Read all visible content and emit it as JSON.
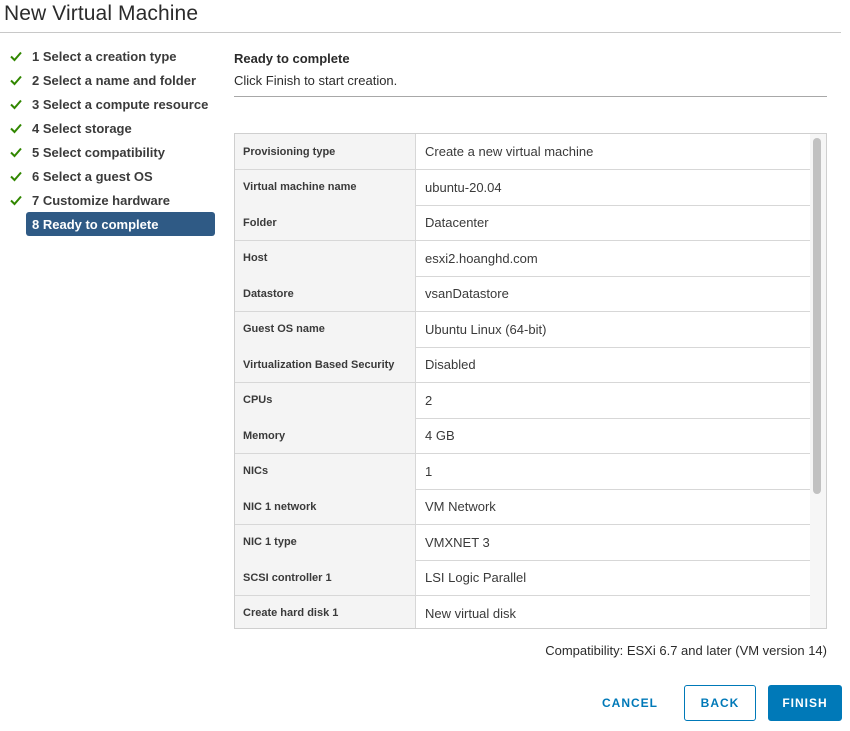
{
  "window": {
    "title": "New Virtual Machine"
  },
  "steps": [
    {
      "label": "1 Select a creation type",
      "done": true
    },
    {
      "label": "2 Select a name and folder",
      "done": true
    },
    {
      "label": "3 Select a compute resource",
      "done": true
    },
    {
      "label": "4 Select storage",
      "done": true
    },
    {
      "label": "5 Select compatibility",
      "done": true
    },
    {
      "label": "6 Select a guest OS",
      "done": true
    },
    {
      "label": "7 Customize hardware",
      "done": true
    },
    {
      "label": "8 Ready to complete",
      "done": false,
      "active": true
    }
  ],
  "pane": {
    "title": "Ready to complete",
    "subtitle": "Click Finish to start creation."
  },
  "summary": [
    {
      "label": "Provisioning type",
      "value": "Create a new virtual machine"
    },
    {
      "label": "Virtual machine name",
      "value": "ubuntu-20.04"
    },
    {
      "label": "Folder",
      "value": "Datacenter"
    },
    {
      "label": "Host",
      "value": "esxi2.hoanghd.com"
    },
    {
      "label": "Datastore",
      "value": "vsanDatastore"
    },
    {
      "label": "Guest OS name",
      "value": "Ubuntu Linux (64-bit)"
    },
    {
      "label": "Virtualization Based Security",
      "value": "Disabled"
    },
    {
      "label": "CPUs",
      "value": "2"
    },
    {
      "label": "Memory",
      "value": "4 GB"
    },
    {
      "label": "NICs",
      "value": "1"
    },
    {
      "label": "NIC 1 network",
      "value": "VM Network"
    },
    {
      "label": "NIC 1 type",
      "value": "VMXNET 3"
    },
    {
      "label": "SCSI controller 1",
      "value": "LSI Logic Parallel"
    },
    {
      "label": "Create hard disk 1",
      "value": "New virtual disk"
    }
  ],
  "compatibility": "Compatibility: ESXi 6.7 and later (VM version 14)",
  "buttons": {
    "cancel": "CANCEL",
    "back": "BACK",
    "finish": "FINISH"
  },
  "colors": {
    "accent": "#0079b8",
    "active_step": "#2f5a85",
    "check": "#318700"
  },
  "icons": {
    "step_done": "check-icon"
  }
}
